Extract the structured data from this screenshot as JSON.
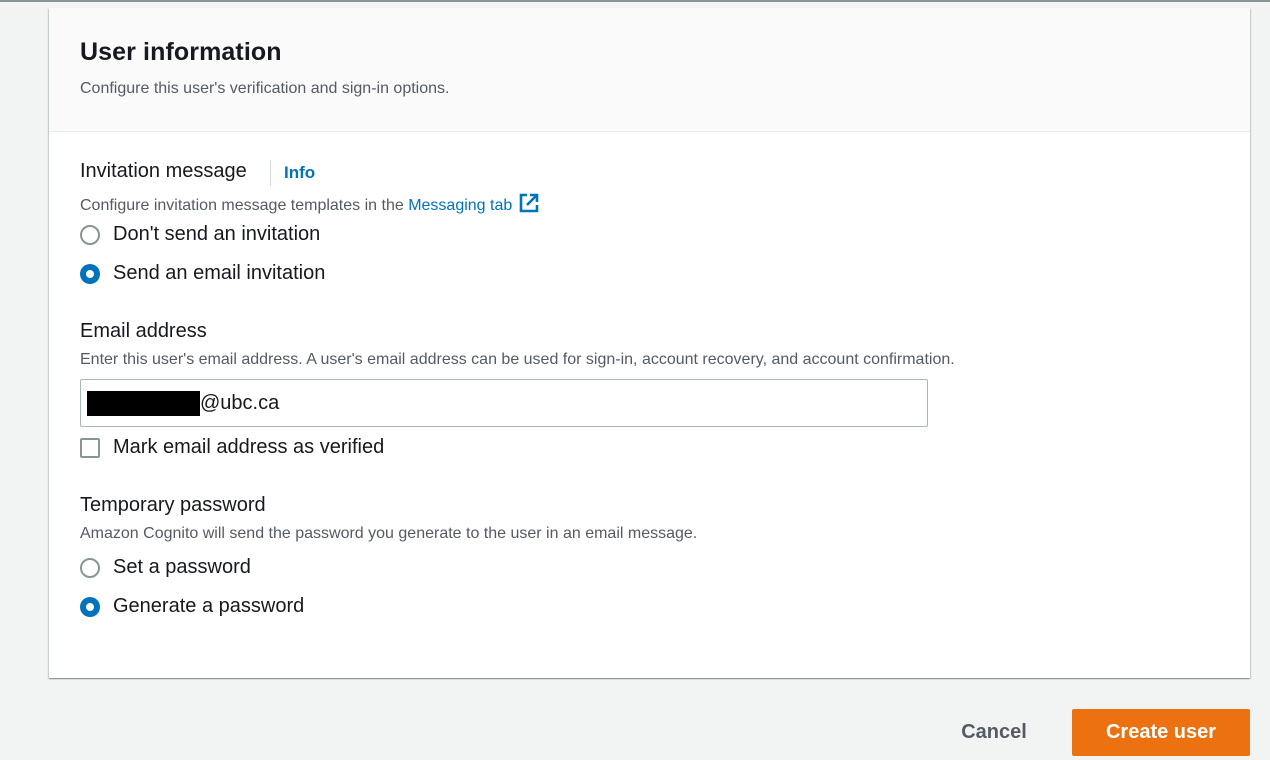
{
  "section": {
    "title": "User information",
    "description": "Configure this user's verification and sign-in options."
  },
  "invitation": {
    "label": "Invitation message",
    "info_link": "Info",
    "description_prefix": "Configure invitation message templates in the ",
    "messaging_link": "Messaging tab",
    "options": [
      {
        "label": "Don't send an invitation",
        "selected": false
      },
      {
        "label": "Send an email invitation",
        "selected": true
      }
    ]
  },
  "email": {
    "label": "Email address",
    "description": "Enter this user's email address. A user's email address can be used for sign-in, account recovery, and account confirmation.",
    "value_suffix": "@ubc.ca",
    "verified_checkbox_label": "Mark email address as verified",
    "verified_checked": false
  },
  "password": {
    "label": "Temporary password",
    "description": "Amazon Cognito will send the password you generate to the user in an email message.",
    "options": [
      {
        "label": "Set a password",
        "selected": false
      },
      {
        "label": "Generate a password",
        "selected": true
      }
    ]
  },
  "actions": {
    "cancel_label": "Cancel",
    "create_label": "Create user"
  },
  "colors": {
    "primary_button": "#ec7211",
    "link": "#0073bb",
    "radio_selected": "#0073bb"
  }
}
